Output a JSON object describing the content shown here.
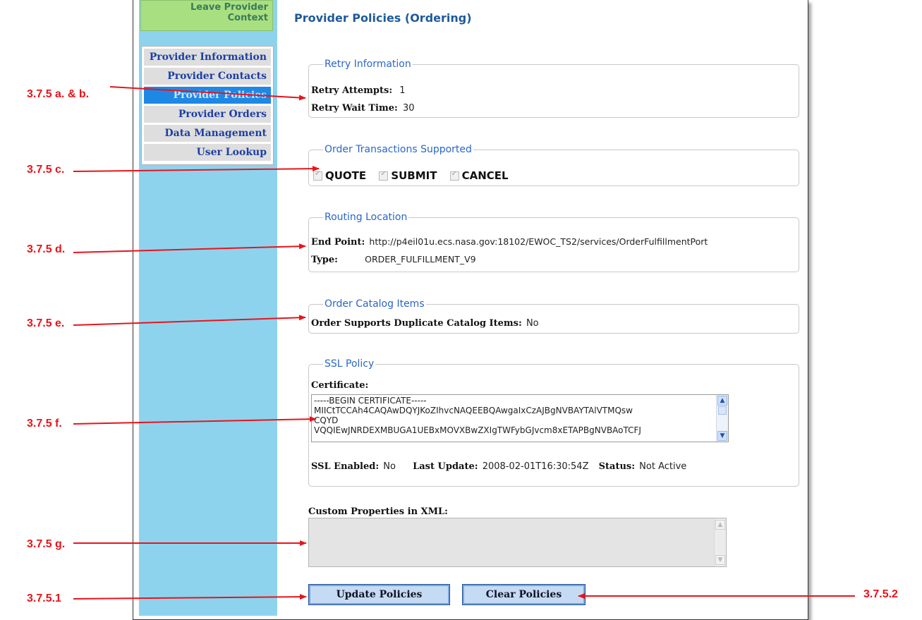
{
  "sidebar": {
    "leave_line1": "Leave Provider",
    "leave_line2": "Context",
    "items": [
      {
        "label": "Provider Information"
      },
      {
        "label": "Provider Contacts"
      },
      {
        "label": "Provider Policies"
      },
      {
        "label": "Provider Orders"
      },
      {
        "label": "Data Management"
      },
      {
        "label": "User Lookup"
      }
    ],
    "active_item": "Provider Policies"
  },
  "page": {
    "title": "Provider Policies (Ordering)"
  },
  "retry": {
    "legend": "Retry Information",
    "attempts_label": "Retry Attempts:",
    "attempts_value": "1",
    "wait_label": "Retry Wait Time:",
    "wait_value": "30"
  },
  "transactions": {
    "legend": "Order Transactions Supported",
    "options": [
      {
        "label": "QUOTE",
        "checked": true
      },
      {
        "label": "SUBMIT",
        "checked": true
      },
      {
        "label": "CANCEL",
        "checked": true
      }
    ]
  },
  "routing": {
    "legend": "Routing Location",
    "endpoint_label": "End Point:",
    "endpoint_value": "http://p4eil01u.ecs.nasa.gov:18102/EWOC_TS2/services/OrderFulfillmentPort",
    "type_label": "Type:",
    "type_value": "ORDER_FULFILLMENT_V9"
  },
  "catalog": {
    "legend": "Order Catalog Items",
    "dup_label": "Order Supports Duplicate Catalog Items:",
    "dup_value": "No"
  },
  "ssl": {
    "legend": "SSL Policy",
    "cert_label": "Certificate:",
    "cert_text": "-----BEGIN CERTIFICATE-----\nMIICtTCCAh4CAQAwDQYJKoZIhvcNAQEEBQAwgaIxCzAJBgNVBAYTAlVTMQsw\nCQYD\nVQQIEwJNRDEXMBUGA1UEBxMOVXBwZXIgTWFybGJvcm8xETAPBgNVBAoTCFJ",
    "enabled_label": "SSL Enabled:",
    "enabled_value": "No",
    "update_label": "Last Update:",
    "update_value": "2008-02-01T16:30:54Z",
    "status_label": "Status:",
    "status_value": "Not Active"
  },
  "custom": {
    "label": "Custom Properties in XML:",
    "value": ""
  },
  "buttons": {
    "update": "Update Policies",
    "clear": "Clear Policies"
  },
  "annotations": {
    "a_b": "3.7.5 a. & b.",
    "c": "3.7.5 c.",
    "d": "3.7.5 d.",
    "e": "3.7.5 e.",
    "f": "3.7.5 f.",
    "g": "3.7.5 g.",
    "n1": "3.7.5.1",
    "n2": "3.7.5.2"
  },
  "colors": {
    "annotation": "#e8141b",
    "sidebar_bg": "#8ed3ee",
    "active_nav": "#1e88e5",
    "legend": "#2a66c8"
  }
}
